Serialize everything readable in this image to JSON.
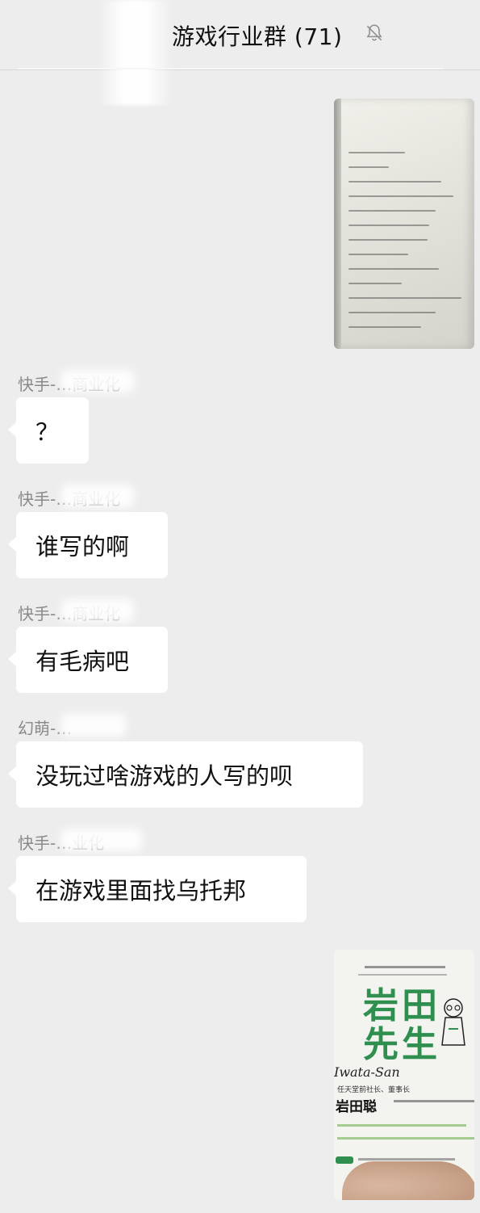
{
  "header": {
    "title": "游戏行业群 (71)",
    "muted": true
  },
  "messages": [
    {
      "type": "image",
      "side": "right",
      "image_text": [
        "对于市面上的网络游戏，",
        "我是这么看的：",
        "无论怎么说，那基本上就是属于弱者的地方，",
        "一个人的幸福要建立在成百上千人的不幸之上。",
        "当然，我不能否定在设计这样的构造时，",
        "但是只要这种需要存在，无论如何，",
        "我认为它的流行会有一定的限度。",
        "就算它看上去再有趣，",
        "还会有许多人在门前踌躇着不要迈进去。",
        "因此，超这种形式之外，",
        "怎样能做出让父母安心允许孩子去玩的网络游戏？",
        "怎样创造出没有欺凌弱小的世界？",
        "我们始终在探讨这些议题。"
      ]
    },
    {
      "type": "text",
      "sender": "快手-…商业化",
      "text": "？"
    },
    {
      "type": "text",
      "sender": "快手-…商业化",
      "text": "谁写的啊"
    },
    {
      "type": "text",
      "sender": "快手-…商业化",
      "text": "有毛病吧"
    },
    {
      "type": "text",
      "sender": "幻萌-…",
      "text": "没玩过啥游戏的人写的呗"
    },
    {
      "type": "text",
      "sender": "快手-…业化",
      "text": "在游戏里面找乌托邦"
    },
    {
      "type": "image",
      "side": "right",
      "book_title": "岩田先生",
      "book_script": "Iwata-San",
      "book_role": "任天堂前社长、董事长",
      "book_author": "岩田聪"
    }
  ],
  "colors": {
    "background": "#ededed",
    "bubble": "#ffffff",
    "sender_text": "#8a8a8a",
    "book_green": "#2e8f4f"
  }
}
